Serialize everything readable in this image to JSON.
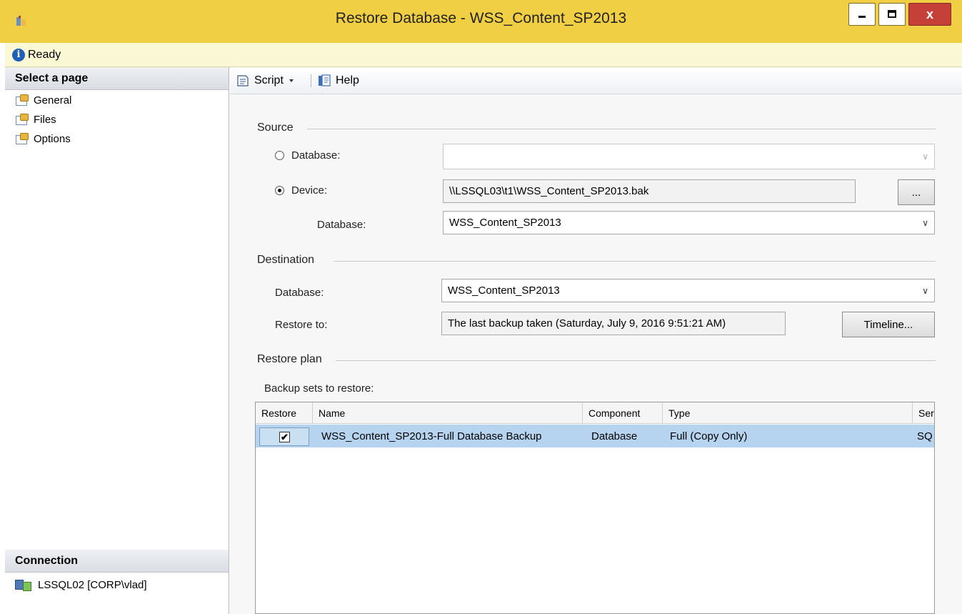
{
  "window": {
    "title": "Restore Database - WSS_Content_SP2013",
    "close_label": "x"
  },
  "status": {
    "text": "Ready"
  },
  "left_panel": {
    "select_page_header": "Select a page",
    "pages": [
      {
        "label": "General"
      },
      {
        "label": "Files"
      },
      {
        "label": "Options"
      }
    ],
    "connection_header": "Connection",
    "connection_text": "LSSQL02 [CORP\\vlad]"
  },
  "toolbar": {
    "script_label": "Script",
    "help_label": "Help"
  },
  "source": {
    "title": "Source",
    "database_radio_label": "Database:",
    "database_value": "",
    "device_radio_label": "Device:",
    "device_value": "\\\\LSSQL03\\t1\\WSS_Content_SP2013.bak",
    "browse_label": "...",
    "database_label": "Database:",
    "device_database_value": "WSS_Content_SP2013",
    "selected": "Device"
  },
  "destination": {
    "title": "Destination",
    "database_label": "Database:",
    "database_value": "WSS_Content_SP2013",
    "restore_to_label": "Restore to:",
    "restore_to_value": "The last backup taken (Saturday, July 9, 2016 9:51:21 AM)",
    "timeline_label": "Timeline..."
  },
  "restore_plan": {
    "title": "Restore plan",
    "backup_sets_label": "Backup sets to restore:",
    "columns": [
      "Restore",
      "Name",
      "Component",
      "Type",
      "Ser"
    ],
    "rows": [
      {
        "restore": true,
        "name": "WSS_Content_SP2013-Full Database Backup",
        "component": "Database",
        "type": "Full (Copy Only)",
        "server": "SQ"
      }
    ]
  },
  "colors": {
    "title_bar": "#f0cf44",
    "status_bar": "#fbf8d6",
    "selected_row": "#b6d4ef",
    "close_button": "#c6403a"
  }
}
